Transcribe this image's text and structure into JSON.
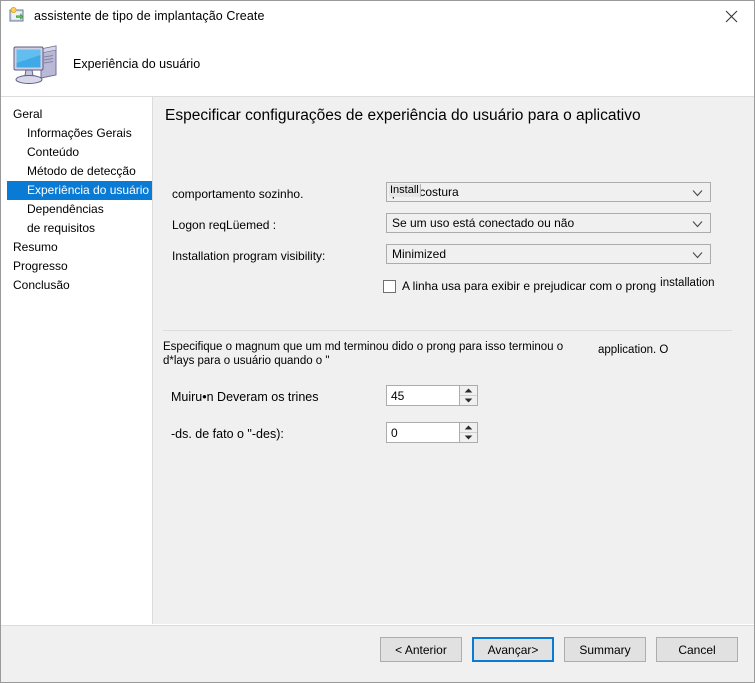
{
  "window": {
    "title": "assistente de tipo de implantação Create",
    "title_icon": "wizard-icon",
    "close_icon": "close-icon"
  },
  "banner": {
    "icon": "computer-icon",
    "title": "Experiência do usuário"
  },
  "sidebar": {
    "items": [
      {
        "label": "Geral",
        "level": 0,
        "selected": false
      },
      {
        "label": "Informações Gerais",
        "level": 1,
        "selected": false
      },
      {
        "label": "Conteúdo",
        "level": 1,
        "selected": false
      },
      {
        "label": "Método de detecção",
        "level": 1,
        "selected": false
      },
      {
        "label": "Experiência do usuário",
        "level": 1,
        "selected": true
      },
      {
        "label": "Dependências",
        "level": 1,
        "selected": false
      },
      {
        "label": " de requisitos",
        "level": 1,
        "selected": false
      },
      {
        "label": "Resumo",
        "level": 0,
        "selected": false
      },
      {
        "label": "Progresso",
        "level": 0,
        "selected": false
      },
      {
        "label": "Conclusão",
        "level": 0,
        "selected": false
      }
    ]
  },
  "main": {
    "heading": "Especificar configurações de experiência do usuário para o aplicativo",
    "fields": [
      {
        "label": "comportamento sozinho.",
        "value": "para costura",
        "overlay": "Install",
        "name": "install-behavior"
      },
      {
        "label": "Logon reqLüemed :",
        "value": "Se um uso está conectado ou não",
        "overlay": "",
        "name": "logon-requirement"
      },
      {
        "label": "Installation program visibility:",
        "value": "Minimized",
        "overlay": "",
        "name": "installation-visibility"
      }
    ],
    "checkbox": {
      "label": "A linha usa para exibir e prejudicar com o prong",
      "extra": "installation",
      "checked": false
    },
    "description": "Especifique o magnum que um md terminou dido o prong para isso terminou o d*lays para o usuário quando o \"",
    "description_tail": "application. O",
    "spinners": [
      {
        "label": "Muiru•n Deveram os trines",
        "value": "45",
        "name": "max-runtime"
      },
      {
        "label": "-ds. de fato o \"-des):",
        "value": "0",
        "name": "estimated-install-time"
      }
    ]
  },
  "footer": {
    "buttons": [
      {
        "label": "< Anterior",
        "name": "previous-button",
        "default": false
      },
      {
        "label": "Avançar>",
        "name": "next-button",
        "default": true
      },
      {
        "label": "Summary",
        "name": "summary-button",
        "default": false
      },
      {
        "label": "Cancel",
        "name": "cancel-button",
        "default": false
      }
    ]
  },
  "colors": {
    "accent": "#0a7bd4",
    "window_bg": "#f0f0f0",
    "panel_bg": "#ffffff"
  }
}
